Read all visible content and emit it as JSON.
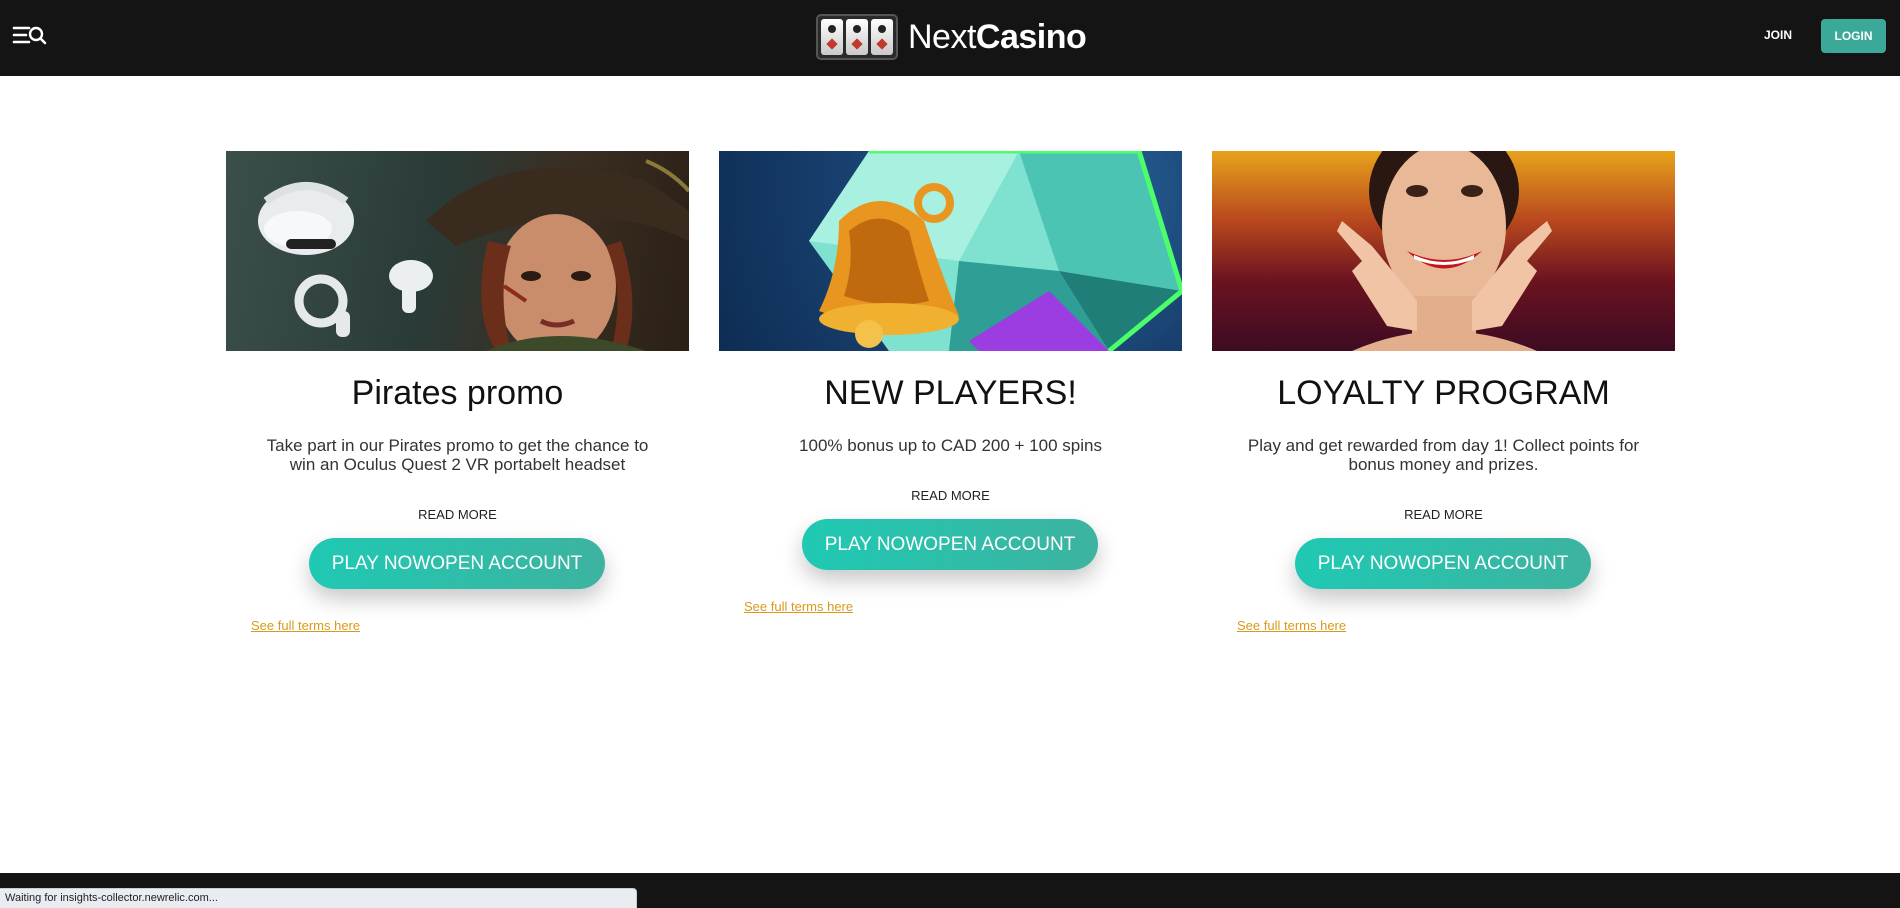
{
  "header": {
    "brand_light": "Next",
    "brand_bold": "Casino",
    "join_label": "JOIN",
    "login_label": "LOGIN"
  },
  "promos": [
    {
      "title": "Pirates promo",
      "description": "Take part in our Pirates promo to get the chance to win an Oculus Quest 2 VR portabelt headset",
      "read_more": "READ MORE",
      "cta": "PLAY NOWOPEN ACCOUNT",
      "terms": "See full terms here",
      "image": "pirate-woman-vr-headset"
    },
    {
      "title": "NEW PLAYERS!",
      "description": "100% bonus up to CAD 200 + 100 spins",
      "read_more": "READ MORE",
      "cta": "PLAY NOWOPEN ACCOUNT",
      "terms": "See full terms here",
      "image": "golden-bell-diamond"
    },
    {
      "title": "LOYALTY PROGRAM",
      "description": "Play and get rewarded from day 1! Collect points for bonus money and prizes.",
      "read_more": "READ MORE",
      "cta": "PLAY NOWOPEN ACCOUNT",
      "terms": "See full terms here",
      "image": "smiling-woman"
    }
  ],
  "status_bar": {
    "text": "Waiting for insights-collector.newrelic.com..."
  },
  "colors": {
    "topbar": "#141414",
    "accent": "#3aa99a",
    "cta_gradient_start": "#1fc9b3",
    "cta_gradient_end": "#3db3a0",
    "terms_link": "#d99a1c"
  }
}
